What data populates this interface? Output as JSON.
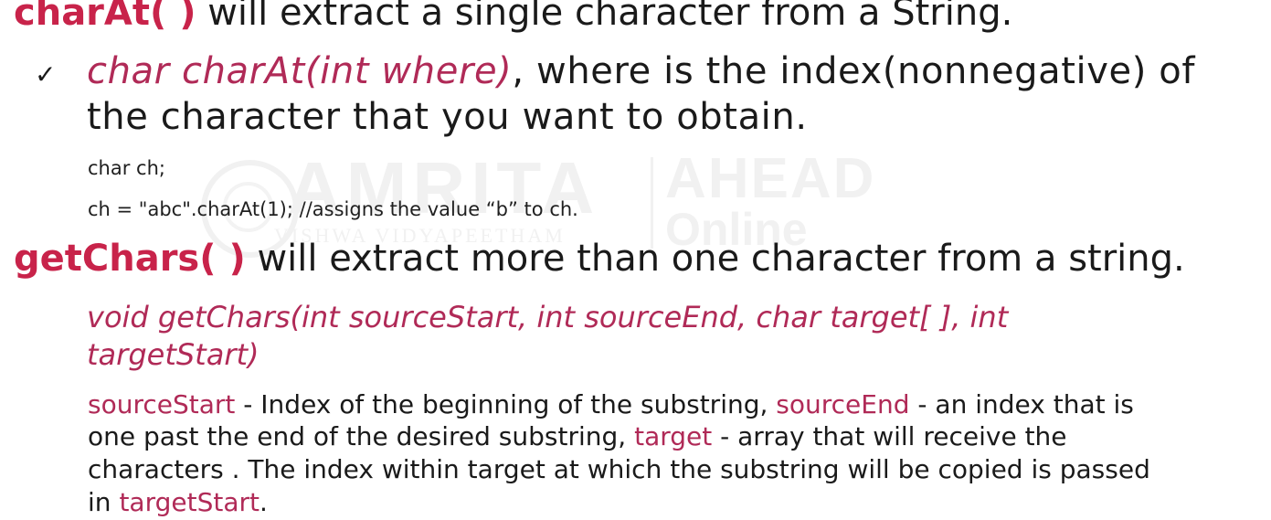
{
  "watermark": {
    "brand": "AMRITA",
    "sub": "VISHWA VIDYAPEETHAM",
    "ahead": "AHEAD",
    "online": "Online"
  },
  "charat": {
    "method": "charAt( )",
    "desc": " will extract a single character from a String.",
    "bullet_mark": "✓",
    "sig": "char charAt(int where)",
    "sig_rest_line1": ", where is the index(nonnegative) of",
    "sig_rest_line2": "the character that you want to obtain.",
    "code_line1": "char ch;",
    "code_line2": "ch = \"abc\".charAt(1); //assigns the value “b” to ch."
  },
  "getchars": {
    "method": "getChars( )",
    "desc": " will extract more than one character from a string.",
    "sig_line1": "void getChars(int sourceStart, int sourceEnd, char target[ ], int",
    "sig_line2": "targetStart)",
    "p_sourceStart": "sourceStart",
    "p_text1": " - Index of the beginning of the substring, ",
    "p_sourceEnd": "sourceEnd",
    "p_text2": " - an index that is",
    "p_line2a": "one past the end of the desired substring, ",
    "p_target": "target",
    "p_line2b": " - array that will receive the",
    "p_line3": "characters . The index within target at which the substring will be copied is passed",
    "p_line4a": "in ",
    "p_targetStart": "targetStart",
    "p_line4b": "."
  }
}
